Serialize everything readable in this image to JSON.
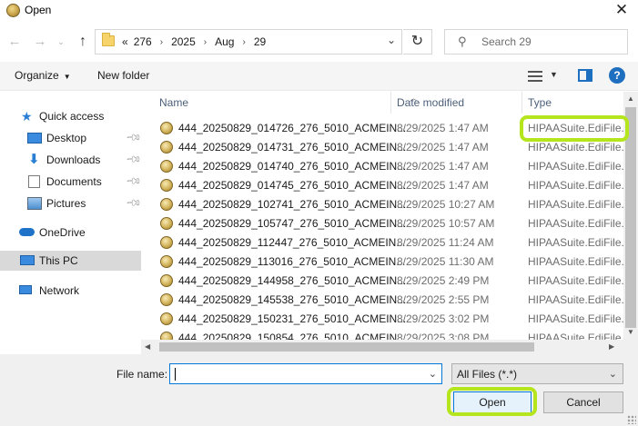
{
  "window": {
    "title": "Open",
    "close_glyph": "✕"
  },
  "address": {
    "crumbs": [
      "276",
      "2025",
      "Aug",
      "29"
    ],
    "overflow_glyph": "«",
    "separator_glyph": "›"
  },
  "search": {
    "placeholder": "Search 29"
  },
  "toolbar": {
    "organize_label": "Organize",
    "new_folder_label": "New folder"
  },
  "nav_pane": {
    "items": [
      {
        "label": "Quick access",
        "icon": "star-icon",
        "pinned": false
      },
      {
        "label": "Desktop",
        "icon": "desktop-icon",
        "pinned": true
      },
      {
        "label": "Downloads",
        "icon": "download-icon",
        "pinned": true
      },
      {
        "label": "Documents",
        "icon": "documents-icon",
        "pinned": true
      },
      {
        "label": "Pictures",
        "icon": "pictures-icon",
        "pinned": true
      },
      {
        "label": "OneDrive",
        "icon": "cloud-icon",
        "pinned": false
      },
      {
        "label": "This PC",
        "icon": "computer-icon",
        "pinned": false,
        "selected": true
      },
      {
        "label": "Network",
        "icon": "network-icon",
        "pinned": false
      }
    ]
  },
  "file_list": {
    "columns": [
      "Name",
      "Date modified",
      "Type"
    ],
    "rows": [
      {
        "name": "444_20250829_014726_276_5010_ACMEIN...",
        "date": "8/29/2025 1:47 AM",
        "type": "HIPAASuite.EdiFile..."
      },
      {
        "name": "444_20250829_014731_276_5010_ACMEIN...",
        "date": "8/29/2025 1:47 AM",
        "type": "HIPAASuite.EdiFile..."
      },
      {
        "name": "444_20250829_014740_276_5010_ACMEIN...",
        "date": "8/29/2025 1:47 AM",
        "type": "HIPAASuite.EdiFile..."
      },
      {
        "name": "444_20250829_014745_276_5010_ACMEIN...",
        "date": "8/29/2025 1:47 AM",
        "type": "HIPAASuite.EdiFile..."
      },
      {
        "name": "444_20250829_102741_276_5010_ACMEIN...",
        "date": "8/29/2025 10:27 AM",
        "type": "HIPAASuite.EdiFile..."
      },
      {
        "name": "444_20250829_105747_276_5010_ACMEIN...",
        "date": "8/29/2025 10:57 AM",
        "type": "HIPAASuite.EdiFile..."
      },
      {
        "name": "444_20250829_112447_276_5010_ACMEIN...",
        "date": "8/29/2025 11:24 AM",
        "type": "HIPAASuite.EdiFile..."
      },
      {
        "name": "444_20250829_113016_276_5010_ACMEIN...",
        "date": "8/29/2025 11:30 AM",
        "type": "HIPAASuite.EdiFile..."
      },
      {
        "name": "444_20250829_144958_276_5010_ACMEIN...",
        "date": "8/29/2025 2:49 PM",
        "type": "HIPAASuite.EdiFile..."
      },
      {
        "name": "444_20250829_145538_276_5010_ACMEIN...",
        "date": "8/29/2025 2:55 PM",
        "type": "HIPAASuite.EdiFile..."
      },
      {
        "name": "444_20250829_150231_276_5010_ACMEIN...",
        "date": "8/29/2025 3:02 PM",
        "type": "HIPAASuite.EdiFile..."
      },
      {
        "name": "444_20250829_150854_276_5010_ACMEIN...",
        "date": "8/29/2025 3:08 PM",
        "type": "HIPAASuite.EdiFile..."
      }
    ]
  },
  "footer": {
    "file_name_label": "File name:",
    "file_name_value": "",
    "filter_value": "All Files (*.*)",
    "open_label": "Open",
    "cancel_label": "Cancel"
  },
  "colors": {
    "highlight": "#b5e61d",
    "accent": "#0078d7"
  }
}
